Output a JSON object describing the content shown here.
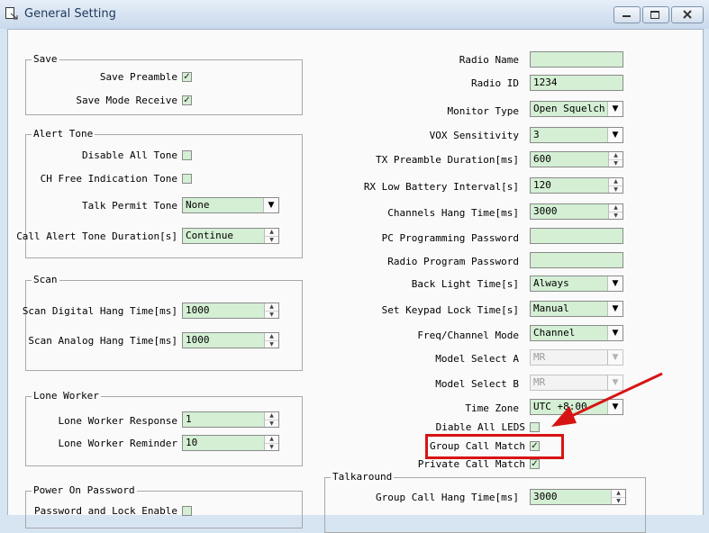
{
  "window": {
    "title": "General Setting"
  },
  "save": {
    "title": "Save",
    "preamble_label": "Save Preamble",
    "preamble_checked": "✓",
    "mode_receive_label": "Save Mode Receive",
    "mode_receive_checked": "✓"
  },
  "alert_tone": {
    "title": "Alert Tone",
    "disable_all_label": "Disable All Tone",
    "ch_free_label": "CH Free Indication Tone",
    "talk_permit_label": "Talk Permit Tone",
    "talk_permit_value": "None",
    "call_alert_label": "Call Alert Tone Duration[s]",
    "call_alert_value": "Continue"
  },
  "scan": {
    "title": "Scan",
    "digital_label": "Scan Digital Hang Time[ms]",
    "digital_value": "1000",
    "analog_label": "Scan Analog Hang Time[ms]",
    "analog_value": "1000"
  },
  "lone_worker": {
    "title": "Lone Worker",
    "response_label": "Lone Worker Response",
    "response_value": "1",
    "reminder_label": "Lone Worker Reminder",
    "reminder_value": "10"
  },
  "power_on": {
    "title": "Power On Password",
    "lock_enable_label": "Password and Lock Enable"
  },
  "right": {
    "radio_name_label": "Radio Name",
    "radio_name_value": "",
    "radio_id_label": "Radio ID",
    "radio_id_value": "1234",
    "monitor_type_label": "Monitor Type",
    "monitor_type_value": "Open Squelch",
    "vox_label": "VOX Sensitivity",
    "vox_value": "3",
    "tx_preamble_label": "TX Preamble Duration[ms]",
    "tx_preamble_value": "600",
    "rx_low_battery_label": "RX Low Battery Interval[s]",
    "rx_low_battery_value": "120",
    "channels_hang_label": "Channels Hang Time[ms]",
    "channels_hang_value": "3000",
    "pc_prog_pwd_label": "PC Programming Password",
    "pc_prog_pwd_value": "",
    "radio_prog_pwd_label": "Radio Program Password",
    "radio_prog_pwd_value": "",
    "back_light_label": "Back Light Time[s]",
    "back_light_value": "Always",
    "keypad_lock_label": "Set Keypad Lock Time[s]",
    "keypad_lock_value": "Manual",
    "freq_channel_label": "Freq/Channel Mode",
    "freq_channel_value": "Channel",
    "model_a_label": "Model Select A",
    "model_a_value": "MR",
    "model_b_label": "Model Select B",
    "model_b_value": "MR",
    "time_zone_label": "Time Zone",
    "time_zone_value": "UTC +8:00",
    "disable_leds_label": "Diable All LEDS",
    "group_call_match_label": "Group Call Match",
    "group_call_match_checked": "✓",
    "private_call_match_label": "Private Call Match",
    "private_call_match_checked": "✓"
  },
  "talkaround": {
    "title": "Talkaround",
    "group_call_hang_label": "Group Call Hang Time[ms]",
    "group_call_hang_value": "3000"
  },
  "colors": {
    "highlight": "#d71414",
    "field_bg": "#d4efd4"
  }
}
